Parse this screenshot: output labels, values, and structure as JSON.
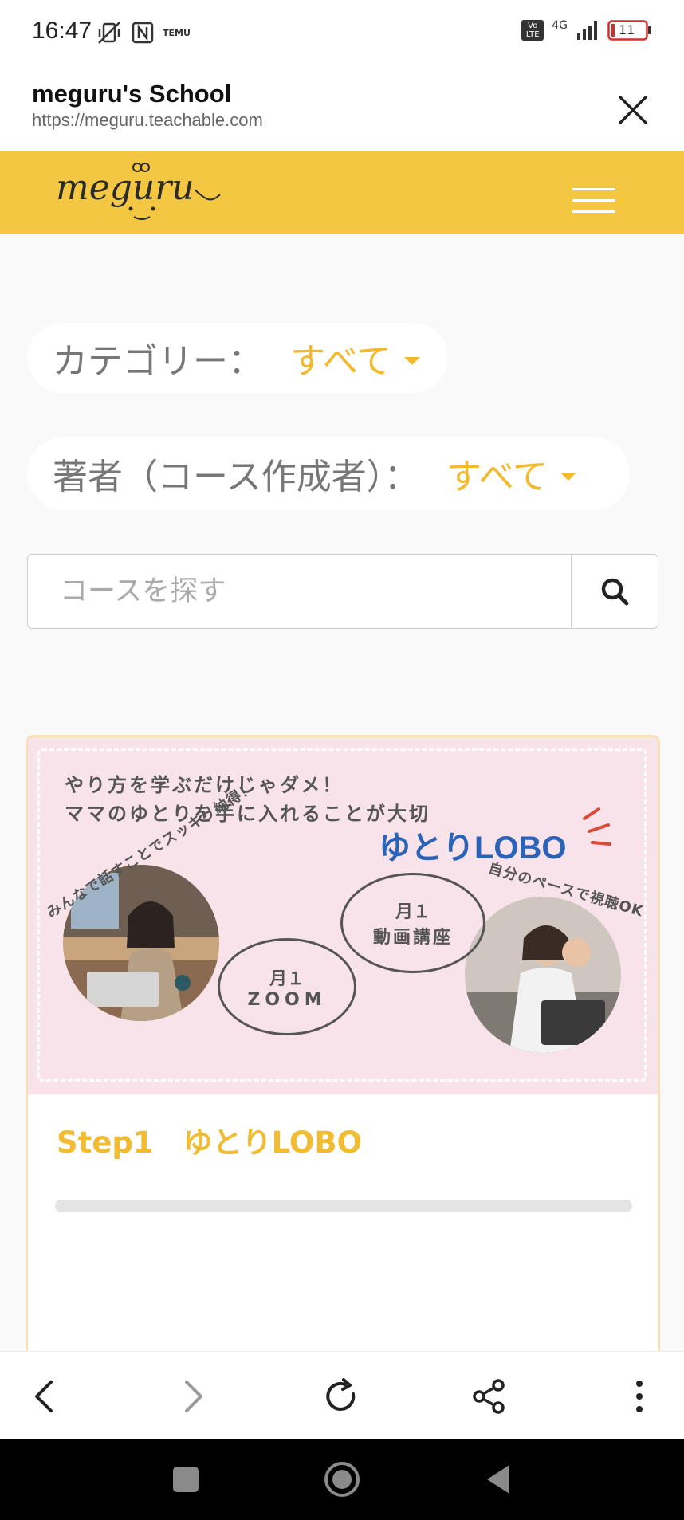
{
  "status": {
    "time": "16:47",
    "battery": "11",
    "network": "4G",
    "lte_label": "Vo LTE",
    "temu_label": "TEMU"
  },
  "browser": {
    "title": "meguru's School",
    "url": "https://meguru.teachable.com"
  },
  "header": {
    "logo_text": "meguru"
  },
  "filters": {
    "category": {
      "label": "カテゴリー：",
      "value": "すべて"
    },
    "author": {
      "label": "著者（コース作成者）：",
      "value": "すべて"
    }
  },
  "search": {
    "placeholder": "コースを探す"
  },
  "course": {
    "banner": {
      "line1": "やり方を学ぶだけじゃダメ！",
      "line2": "ママのゆとりを手に入れることが大切",
      "brand": "ゆとりLOBO",
      "arc_left": "みんなで話すことでスッキリ納得！",
      "arc_right": "自分のペースで視聴OK",
      "bubble_zoom_1": "月１",
      "bubble_zoom_2": "ZOOM",
      "bubble_video_1": "月１",
      "bubble_video_2": "動画講座"
    },
    "title": "Step1　ゆとりLOBO",
    "progress": 0
  },
  "colors": {
    "brand_yellow": "#f4c742",
    "accent_text": "#f2bc32",
    "banner_pink": "#f9e3ea",
    "brand_blue": "#2a63b8"
  }
}
